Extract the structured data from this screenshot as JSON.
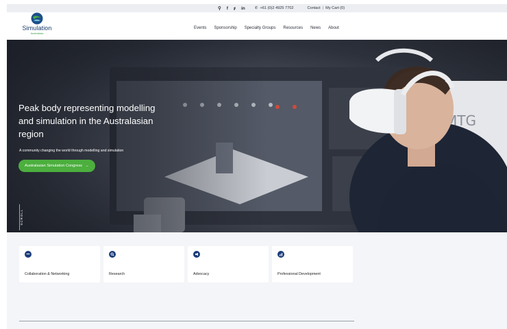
{
  "topbar": {
    "icons": [
      "search-icon",
      "facebook-icon",
      "twitter-icon",
      "linkedin-icon",
      "phone-icon"
    ],
    "phone": "+61 (0)2 4925 7702",
    "contact": "Contact",
    "separator": "|",
    "cart": "My Cart (0)"
  },
  "logo": {
    "name": "Simulation",
    "sub": "Australasia"
  },
  "nav": {
    "items": [
      "Events",
      "Sponsorship",
      "Specialty Groups",
      "Resources",
      "News",
      "About"
    ]
  },
  "hero": {
    "title": "Peak body representing modelling and simulation in the Australasian region",
    "subtitle": "A community changing the world through modelling and simulation",
    "cta": "Australasian Simulation Congress",
    "cta_arrow": "→",
    "scroll": "SCROLL",
    "background_text": "MTG"
  },
  "cards": [
    {
      "label": "Collaboration & Networking",
      "icon": "handshake-icon"
    },
    {
      "label": "Research",
      "icon": "magnifier-icon"
    },
    {
      "label": "Advocacy",
      "icon": "megaphone-icon"
    },
    {
      "label": "Professional Development",
      "icon": "chart-icon"
    }
  ],
  "colors": {
    "brand_navy": "#1b3c7a",
    "accent_green": "#4caf3e",
    "logo_blue": "#163a6b"
  }
}
